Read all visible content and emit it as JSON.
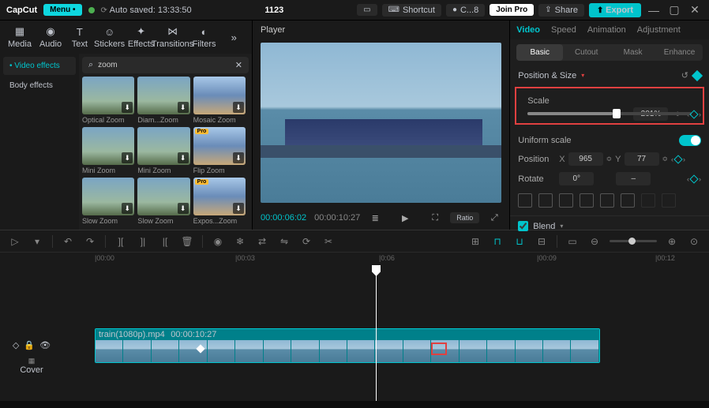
{
  "titlebar": {
    "app": "CapCut",
    "menu": "Menu •",
    "autosave": "Auto saved: 13:33:50",
    "project": "1123",
    "shortcut": "Shortcut",
    "cloud": "C...8",
    "join": "Join Pro",
    "share": "Share",
    "export": "Export"
  },
  "mediaTabs": {
    "media": "Media",
    "audio": "Audio",
    "text": "Text",
    "stickers": "Stickers",
    "effects": "Effects",
    "transitions": "Transitions",
    "filters": "Filters"
  },
  "sidebar": {
    "video": "• Video effects",
    "body": "Body effects"
  },
  "search": {
    "value": "zoom"
  },
  "thumbs": [
    {
      "label": "Optical Zoom",
      "pro": false
    },
    {
      "label": "Diam...Zoom",
      "pro": false
    },
    {
      "label": "Mosaic Zoom",
      "pro": false
    },
    {
      "label": "Mini Zoom",
      "pro": false
    },
    {
      "label": "Mini Zoom",
      "pro": false
    },
    {
      "label": "Flip Zoom",
      "pro": true
    },
    {
      "label": "Slow Zoom",
      "pro": false
    },
    {
      "label": "Slow Zoom",
      "pro": false
    },
    {
      "label": "Expos...Zoom",
      "pro": true
    },
    {
      "label": "",
      "pro": true
    },
    {
      "label": "",
      "pro": false
    },
    {
      "label": "",
      "pro": true
    }
  ],
  "player": {
    "title": "Player",
    "current": "00:00:06:02",
    "total": "00:00:10:27",
    "ratio": "Ratio"
  },
  "inspector": {
    "tabs": {
      "video": "Video",
      "speed": "Speed",
      "animation": "Animation",
      "adjustment": "Adjustment"
    },
    "subtabs": {
      "basic": "Basic",
      "cutout": "Cutout",
      "mask": "Mask",
      "enhance": "Enhance"
    },
    "section": "Position & Size",
    "scale": {
      "label": "Scale",
      "value": "201%"
    },
    "uniform": "Uniform scale",
    "position": {
      "label": "Position",
      "x": "X",
      "xv": "965",
      "y": "Y",
      "yv": "77"
    },
    "rotate": {
      "label": "Rotate",
      "value": "0°",
      "dash": "–"
    },
    "blend": "Blend"
  },
  "ruler": {
    "t0": "|00:00",
    "t1": "|00:03",
    "t2": "|0:06",
    "t3": "|00:09",
    "t4": "|00:12"
  },
  "clip": {
    "name": "train(1080p).mp4",
    "dur": "00:00:10:27"
  },
  "cover": "Cover"
}
